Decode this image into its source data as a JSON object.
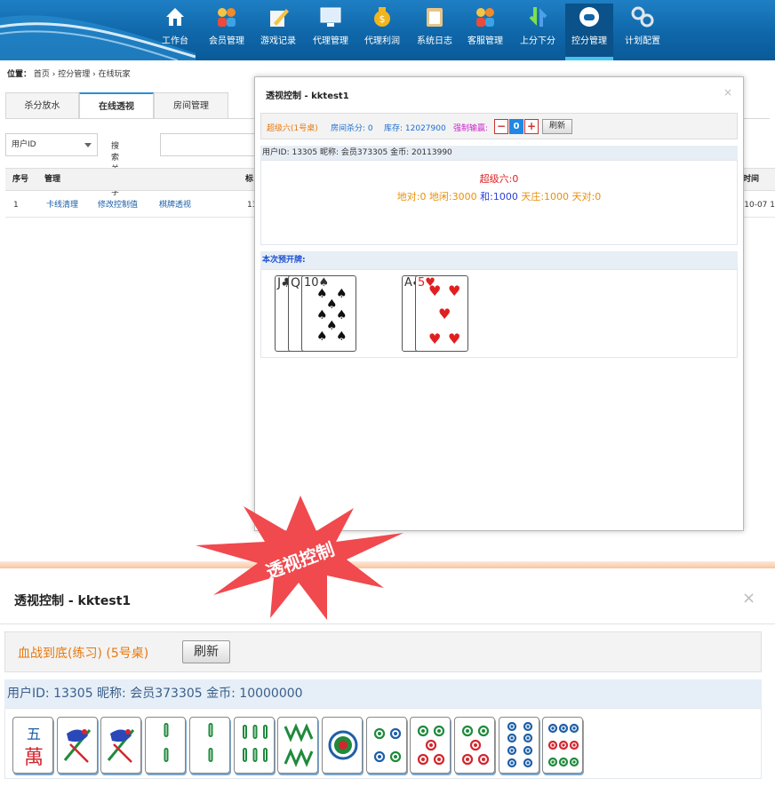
{
  "nav": [
    {
      "label": "工作台",
      "icon": "house-icon"
    },
    {
      "label": "会员管理",
      "icon": "members-icon"
    },
    {
      "label": "游戏记录",
      "icon": "pencil-note-icon"
    },
    {
      "label": "代理管理",
      "icon": "monitor-icon"
    },
    {
      "label": "代理利润",
      "icon": "money-bag-icon"
    },
    {
      "label": "系统日志",
      "icon": "clipboard-icon"
    },
    {
      "label": "客服管理",
      "icon": "support-icon"
    },
    {
      "label": "上分下分",
      "icon": "arrows-icon"
    },
    {
      "label": "控分管理",
      "icon": "gamepad-icon",
      "active": true
    },
    {
      "label": "计划配置",
      "icon": "gears-icon"
    }
  ],
  "breadcrumb": {
    "prefix": "位置：",
    "items": [
      "首页",
      "控分管理",
      "在线玩家"
    ],
    "sep": "›"
  },
  "tabs": [
    {
      "label": "杀分放水"
    },
    {
      "label": "在线透视",
      "active": true
    },
    {
      "label": "房间管理"
    }
  ],
  "filter": {
    "select_value": "用户ID",
    "search_label": "搜索关键字"
  },
  "table": {
    "headers": [
      "序号",
      "管理",
      "标",
      "时间"
    ],
    "row": {
      "index": "1",
      "actions": [
        "卡线清理",
        "修改控制值",
        "棋牌透视"
      ],
      "partial": "13",
      "date": "-10-07 1"
    }
  },
  "modal1": {
    "title": "透视控制 - kktest1",
    "close": "×",
    "room": "超级六(1号桌)",
    "room_kill": "房间杀分: 0",
    "stock": "库存: 12027900",
    "force_label": "强制输赢:",
    "stepper_minus": "−",
    "stepper_value": "0",
    "stepper_plus": "+",
    "refresh": "刷新",
    "userinfo": "用户ID: 13305  昵称: 会员373305  金币: 20113990",
    "result_line1": "超级六:0",
    "result_parts": [
      {
        "text": "地对:0 地闲:3000 ",
        "color": "#e8900c"
      },
      {
        "text": "和:1000",
        "color": "#2a3fd8"
      },
      {
        "text": " 天庄:1000 天对:0",
        "color": "#e8900c"
      }
    ],
    "pre_label": "本次预开牌:",
    "hand_left": [
      "J♣",
      "Q♣",
      "10♠"
    ],
    "hand_right": [
      "A♣",
      "5♥"
    ]
  },
  "burst_text": "透视控制",
  "modal2": {
    "title": "透视控制 - kktest1",
    "close": "×",
    "room": "血战到底(练习) (5号桌)",
    "refresh": "刷新",
    "userinfo": "用户ID: 13305  昵称: 会员373305  金币: 10000000",
    "tiles": [
      "五萬",
      "一条(雀)",
      "一条(雀)",
      "二条",
      "二条",
      "六条",
      "八条",
      "一筒",
      "四筒",
      "五筒",
      "五筒",
      "八筒",
      "九筒"
    ]
  },
  "colors": {
    "header": "#0f67a9",
    "accent": "#2b8ed8",
    "orange": "#e8780c",
    "red": "#e02020"
  }
}
